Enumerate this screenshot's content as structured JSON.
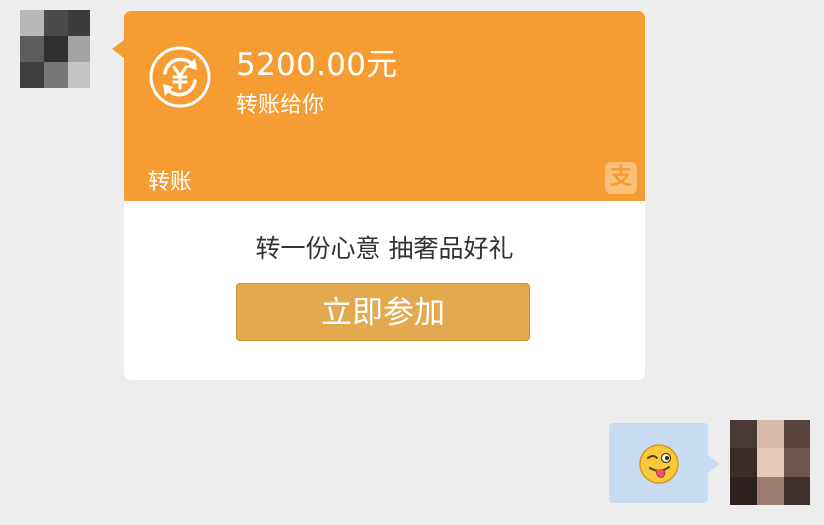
{
  "transfer": {
    "amount": "5200.00元",
    "subtitle": "转账给你",
    "label": "转账",
    "alipay_glyph": "支",
    "promo_text": "转一份心意 抽奢品好礼",
    "button_label": "立即参加"
  },
  "colors": {
    "chat_background": "#ededed",
    "card_header": "#f59c32",
    "button": "#e3a94e",
    "sent_bubble": "#c7dcf2"
  },
  "icons": {
    "transfer_icon": "yuan-exchange-icon",
    "brand_icon": "alipay-icon",
    "sent_emoji": "wink-tongue-emoji-icon"
  }
}
